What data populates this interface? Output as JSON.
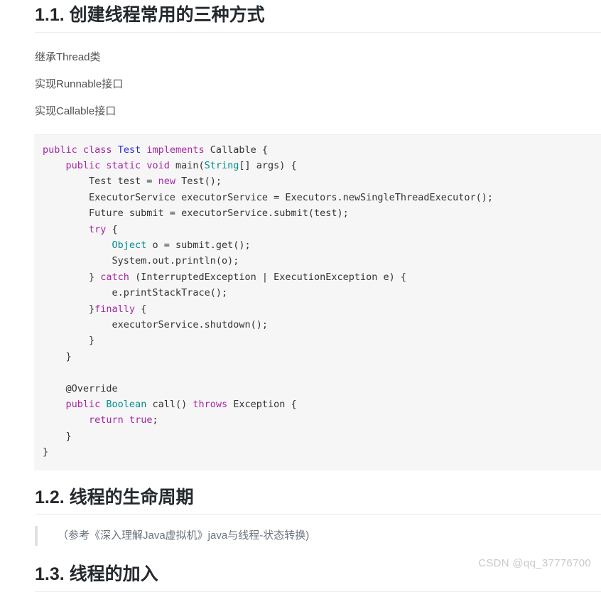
{
  "page": {
    "watermark": "CSDN @qq_37776700"
  },
  "sections": {
    "s1": {
      "heading": "1.1. 创建线程常用的三种方式",
      "paragraphs": [
        "继承Thread类",
        "实现Runnable接口",
        "实现Callable接口"
      ]
    },
    "s2": {
      "heading": "1.2. 线程的生命周期",
      "blockquote": "（参考《深入理解Java虚拟机》java与线程-状态转换)"
    },
    "s3": {
      "heading": "1.3. 线程的加入"
    }
  },
  "code": {
    "language": "java",
    "lines": [
      "public class Test implements Callable {",
      "    public static void main(String[] args) {",
      "        Test test = new Test();",
      "        ExecutorService executorService = Executors.newSingleThreadExecutor();",
      "        Future submit = executorService.submit(test);",
      "        try {",
      "            Object o = submit.get();",
      "            System.out.println(o);",
      "        } catch (InterruptedException | ExecutionException e) {",
      "            e.printStackTrace();",
      "        }finally {",
      "            executorService.shutdown();",
      "        }",
      "    }",
      "",
      "    @Override",
      "    public Boolean call() throws Exception {",
      "        return true;",
      "    }",
      "}"
    ],
    "tokens": [
      [
        [
          "public ",
          "k"
        ],
        [
          "class ",
          "k"
        ],
        [
          "Test ",
          "cls"
        ],
        [
          "implements ",
          "k"
        ],
        [
          "Callable {",
          "pl"
        ]
      ],
      [
        [
          "    ",
          "pl"
        ],
        [
          "public ",
          "k"
        ],
        [
          "static ",
          "k"
        ],
        [
          "void ",
          "k"
        ],
        [
          "main(",
          "pl"
        ],
        [
          "String",
          "ty"
        ],
        [
          "[] args) {",
          "pl"
        ]
      ],
      [
        [
          "        Test test = ",
          "pl"
        ],
        [
          "new ",
          "k"
        ],
        [
          "Test();",
          "pl"
        ]
      ],
      [
        [
          "        ExecutorService executorService = Executors.newSingleThreadExecutor();",
          "pl"
        ]
      ],
      [
        [
          "        Future submit = executorService.submit(test);",
          "pl"
        ]
      ],
      [
        [
          "        ",
          "pl"
        ],
        [
          "try ",
          "k"
        ],
        [
          "{",
          "pl"
        ]
      ],
      [
        [
          "            ",
          "pl"
        ],
        [
          "Object",
          "ty"
        ],
        [
          " o = submit.get();",
          "pl"
        ]
      ],
      [
        [
          "            System.out.println(o);",
          "pl"
        ]
      ],
      [
        [
          "        } ",
          "pl"
        ],
        [
          "catch ",
          "k"
        ],
        [
          "(InterruptedException | ExecutionException e) {",
          "pl"
        ]
      ],
      [
        [
          "            e.printStackTrace();",
          "pl"
        ]
      ],
      [
        [
          "        }",
          "pl"
        ],
        [
          "finally ",
          "k"
        ],
        [
          "{",
          "pl"
        ]
      ],
      [
        [
          "            executorService.shutdown();",
          "pl"
        ]
      ],
      [
        [
          "        }",
          "pl"
        ]
      ],
      [
        [
          "    }",
          "pl"
        ]
      ],
      [
        [
          "",
          "pl"
        ]
      ],
      [
        [
          "    @Override",
          "pl"
        ]
      ],
      [
        [
          "    ",
          "pl"
        ],
        [
          "public ",
          "k"
        ],
        [
          "Boolean ",
          "ty"
        ],
        [
          "call() ",
          "pl"
        ],
        [
          "throws ",
          "k"
        ],
        [
          "Exception {",
          "pl"
        ]
      ],
      [
        [
          "        ",
          "pl"
        ],
        [
          "return ",
          "k"
        ],
        [
          "true",
          "k"
        ],
        [
          ";",
          "pl"
        ]
      ],
      [
        [
          "    }",
          "pl"
        ]
      ],
      [
        [
          "}",
          "pl"
        ]
      ]
    ],
    "colors": {
      "keyword": "#a626a4",
      "class_name": "#2b2bd4",
      "builtin_type": "#008e8e",
      "plain": "#333333",
      "background": "#f6f6f6"
    }
  }
}
